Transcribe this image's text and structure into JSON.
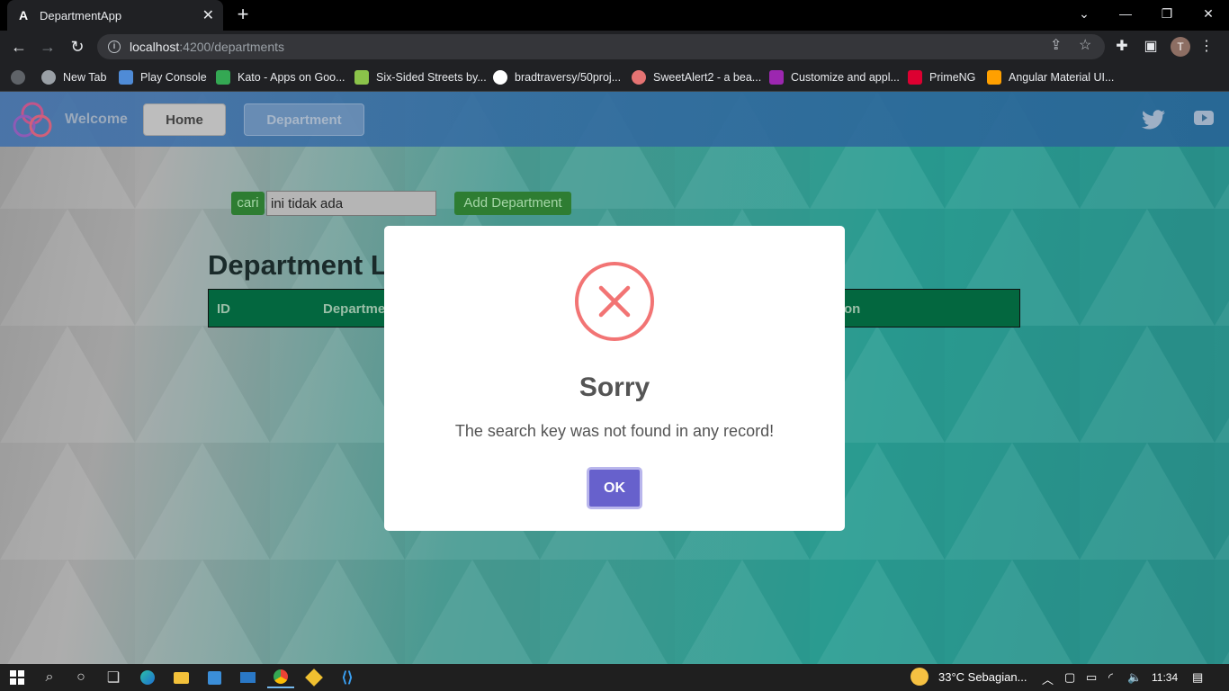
{
  "browser": {
    "tab_title": "DepartmentApp",
    "url_host": "localhost",
    "url_path": ":4200/departments",
    "bookmarks": [
      {
        "label": "New Tab",
        "icon": "globe-icon",
        "color": "#9aa0a6"
      },
      {
        "label": "Play Console",
        "icon": "play-console-icon",
        "color": "#4f8bd6"
      },
      {
        "label": "Kato - Apps on Goo...",
        "icon": "google-play-icon",
        "color": "#34a853"
      },
      {
        "label": "Six-Sided Streets by...",
        "icon": "hexagon-map-icon",
        "color": "#8bc34a"
      },
      {
        "label": "bradtraversy/50proj...",
        "icon": "github-icon",
        "color": "#ffffff"
      },
      {
        "label": "SweetAlert2 - a bea...",
        "icon": "sweetalert-icon",
        "color": "#e57373"
      },
      {
        "label": "Customize and appl...",
        "icon": "crown-icon",
        "color": "#9c27b0"
      },
      {
        "label": "PrimeNG",
        "icon": "primeng-icon",
        "color": "#dd0031"
      },
      {
        "label": "Angular Material UI...",
        "icon": "angular-material-icon",
        "color": "#ffa000"
      }
    ]
  },
  "app": {
    "nav": {
      "welcome": "Welcome",
      "home": "Home",
      "department": "Department"
    },
    "search": {
      "button": "cari",
      "value": "ini tidak ada"
    },
    "add_button": "Add Department",
    "heading": "Department L",
    "table_headers": [
      "ID",
      "Departme",
      "on"
    ]
  },
  "modal": {
    "title": "Sorry",
    "text": "The search key was not found in any record!",
    "ok": "OK",
    "icon": "error-x-icon",
    "accent": "#f27474",
    "button_color": "#6761cc"
  },
  "taskbar": {
    "weather": "33°C  Sebagian...",
    "time": "11:34"
  }
}
